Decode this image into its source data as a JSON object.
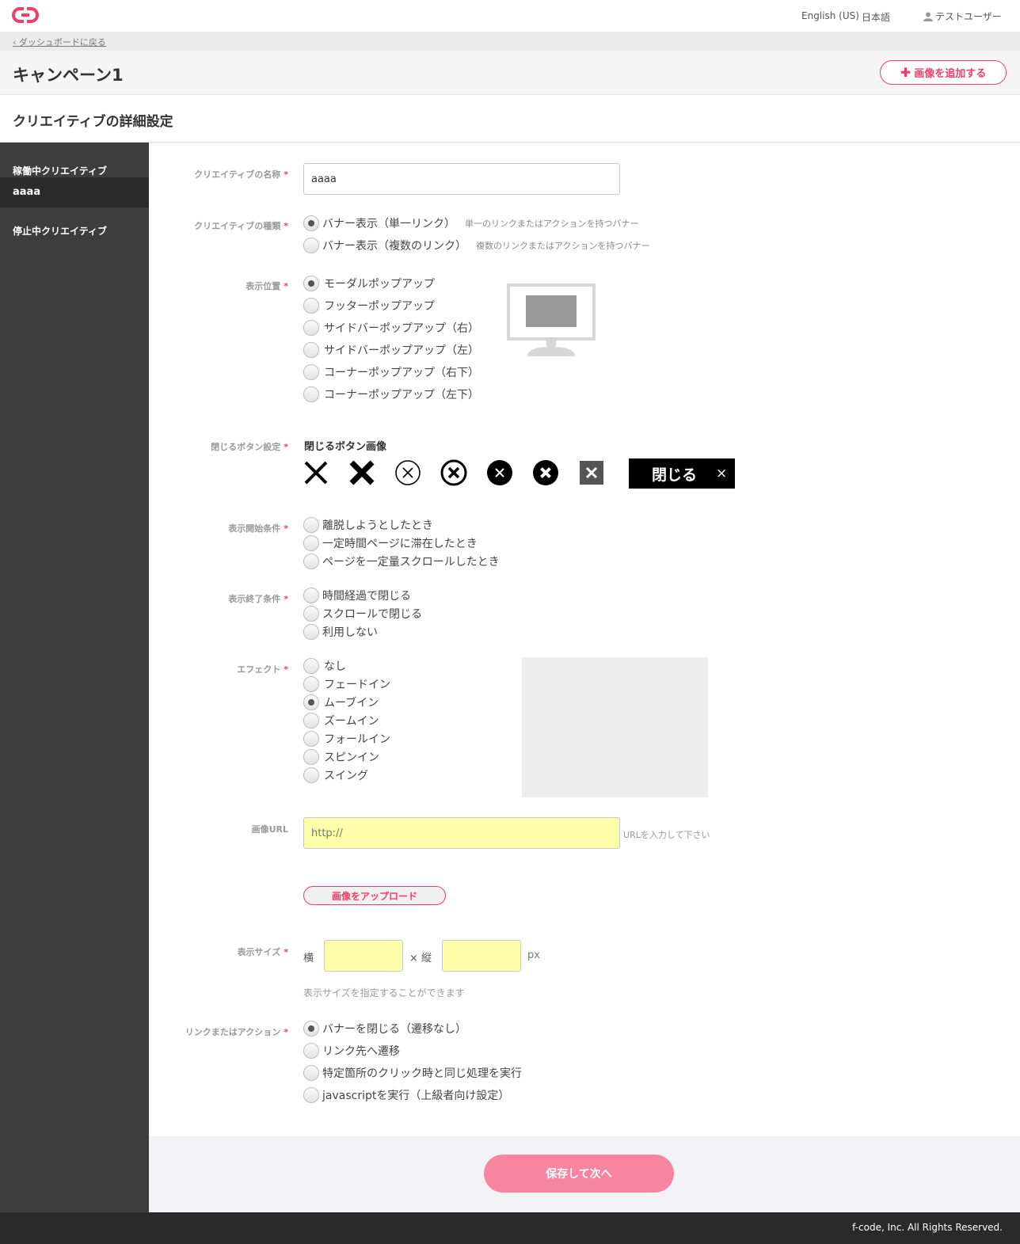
{
  "header": {
    "lang_en": "English (US)",
    "lang_ja": "日本語",
    "user_name": "テストユーザー",
    "logo_icon": "link-logo-icon",
    "brand_color": "#ee3f6c"
  },
  "breadcrumb": {
    "back_label": "ダッシュボードに戻る"
  },
  "page": {
    "title": "キャンペーン1",
    "add_image_label": "画像を追加する",
    "section_title": "クリエイティブの詳細設定"
  },
  "sidebar": {
    "active_heading": "稼働中クリエイティブ",
    "active_item": "aaaa",
    "stopped_heading": "停止中クリエイティブ"
  },
  "form": {
    "required_mark": "*",
    "name": {
      "label": "クリエイティブの名称",
      "value": "aaaa"
    },
    "type": {
      "label": "クリエイティブの種類",
      "options": [
        {
          "label": "バナー表示（単一リンク）",
          "note": "単一のリンクまたはアクションを持つバナー",
          "checked": true
        },
        {
          "label": "バナー表示（複数のリンク）",
          "note": "複数のリンクまたはアクションを持つバナー",
          "checked": false
        }
      ]
    },
    "position": {
      "label": "表示位置",
      "options": [
        {
          "label": "モーダルポップアップ",
          "checked": true
        },
        {
          "label": "フッターポップアップ",
          "checked": false
        },
        {
          "label": "サイドバーポップアップ（右）",
          "checked": false
        },
        {
          "label": "サイドバーポップアップ（左）",
          "checked": false
        },
        {
          "label": "コーナーポップアップ（右下）",
          "checked": false
        },
        {
          "label": "コーナーポップアップ（左下）",
          "checked": false
        }
      ]
    },
    "close_button": {
      "label": "閉じるボタン設定",
      "title": "閉じるボタン画像",
      "text_button_label": "閉じる",
      "text_button_x": "×"
    },
    "start_condition": {
      "label": "表示開始条件",
      "options": [
        {
          "label": "離脱しようとしたとき",
          "checked": false
        },
        {
          "label": "一定時間ページに滞在したとき",
          "checked": false
        },
        {
          "label": "ページを一定量スクロールしたとき",
          "checked": false
        }
      ]
    },
    "end_condition": {
      "label": "表示終了条件",
      "options": [
        {
          "label": "時間経過で閉じる",
          "checked": false
        },
        {
          "label": "スクロールで閉じる",
          "checked": false
        },
        {
          "label": "利用しない",
          "checked": false
        }
      ]
    },
    "effect": {
      "label": "エフェクト",
      "options": [
        {
          "label": "なし",
          "checked": false
        },
        {
          "label": "フェードイン",
          "checked": false
        },
        {
          "label": "ムーブイン",
          "checked": true
        },
        {
          "label": "ズームイン",
          "checked": false
        },
        {
          "label": "フォールイン",
          "checked": false
        },
        {
          "label": "スピンイン",
          "checked": false
        },
        {
          "label": "スイング",
          "checked": false
        }
      ]
    },
    "image_url": {
      "label": "画像URL",
      "placeholder": "http://",
      "hint": "URLを入力して下さい",
      "upload_label": "画像をアップロード"
    },
    "size": {
      "label": "表示サイズ",
      "width_label": "横",
      "height_label": "× 縦",
      "unit": "px",
      "hint": "表示サイズを指定することができます"
    },
    "action": {
      "label": "リンクまたはアクション",
      "options": [
        {
          "label": "バナーを閉じる（遷移なし）",
          "checked": true
        },
        {
          "label": "リンク先へ遷移",
          "checked": false
        },
        {
          "label": "特定箇所のクリック時と同じ処理を実行",
          "checked": false
        },
        {
          "label": "javascriptを実行（上級者向け設定）",
          "checked": false
        }
      ]
    }
  },
  "save_label": "保存して次へ",
  "footer": {
    "copyright": "f-code, Inc. All Rights Reserved."
  }
}
